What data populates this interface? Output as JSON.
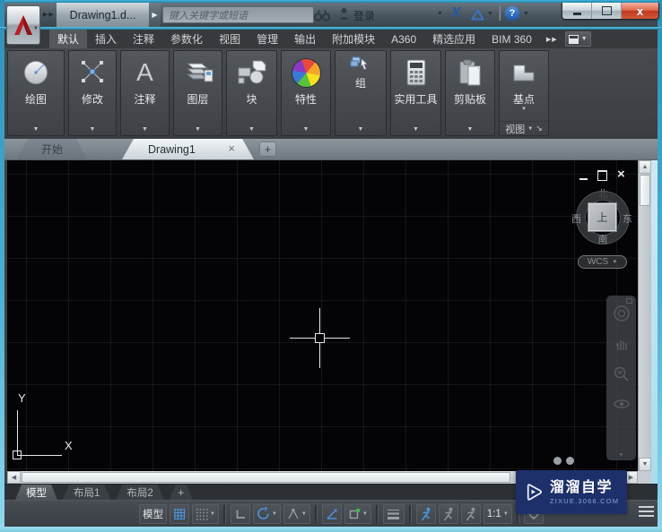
{
  "title_bar": {
    "doc_title": "Drawing1.d...",
    "search_placeholder": "键入关键字或短语",
    "signin_label": "登录"
  },
  "ribbon": {
    "tabs": [
      {
        "label": "默认",
        "active": true
      },
      {
        "label": "插入"
      },
      {
        "label": "注释"
      },
      {
        "label": "参数化"
      },
      {
        "label": "视图"
      },
      {
        "label": "管理"
      },
      {
        "label": "输出"
      },
      {
        "label": "附加模块"
      },
      {
        "label": "A360"
      },
      {
        "label": "精选应用"
      },
      {
        "label": "BIM 360"
      }
    ],
    "panels": [
      {
        "label": "绘图",
        "icon": "draw-circle-icon"
      },
      {
        "label": "修改",
        "icon": "modify-cross-icon"
      },
      {
        "label": "注释",
        "icon": "annotate-a-icon"
      },
      {
        "label": "图层",
        "icon": "layers-stack-icon"
      },
      {
        "label": "块",
        "icon": "block-shapes-icon"
      },
      {
        "label": "特性",
        "icon": "properties-color-wheel-icon"
      },
      {
        "label": "组",
        "icon": "group-cursor-icon"
      },
      {
        "label": "实用工具",
        "icon": "utilities-calculator-icon"
      },
      {
        "label": "剪贴板",
        "icon": "clipboard-icon"
      }
    ],
    "view_panel": {
      "button_label": "基点",
      "footer_label": "视图"
    }
  },
  "file_tabs": {
    "start": "开始",
    "active": "Drawing1"
  },
  "drawing": {
    "viewcube": {
      "north": "北",
      "south": "南",
      "west": "西",
      "east": "东",
      "face": "上",
      "wcs": "WCS"
    },
    "ucs": {
      "x_label": "X",
      "y_label": "Y"
    }
  },
  "layout_tabs": {
    "model": "模型",
    "layout1": "布局1",
    "layout2": "布局2"
  },
  "status_bar": {
    "model_label": "模型",
    "scale_label": "1:1"
  },
  "watermark": {
    "title": "溜溜自学",
    "url": "ZIXUE.3066.COM"
  },
  "icons": {
    "app_logo": "autocad-red-a",
    "title_bar": [
      "search-binoculars",
      "user-person",
      "exchange-x",
      "a360-triangle",
      "help-question"
    ],
    "window_controls": [
      "minimize",
      "maximize",
      "close"
    ],
    "navbar": [
      "navigation-wheel",
      "pan-hand",
      "zoom-magnifier",
      "orbit"
    ],
    "status_toggles": [
      "grid",
      "snap",
      "ortho",
      "polar",
      "isodraft",
      "otrack",
      "osnap",
      "lineweight",
      "annotation-visibility",
      "annotation-autoscale",
      "annotation-scale",
      "customization-menu"
    ]
  },
  "colors": {
    "frame_teal": "#49b0d4",
    "autocad_red": "#b91e23",
    "close_button_red": "#c13a1e",
    "status_active_blue": "#4f94e0",
    "osnap_green": "#35c04e",
    "badge_blue": "#1d3069"
  }
}
